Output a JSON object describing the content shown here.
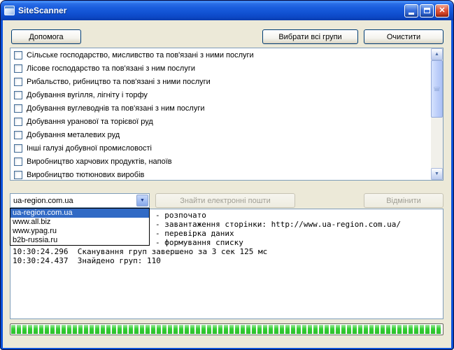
{
  "window": {
    "title": "SiteScanner"
  },
  "toolbar": {
    "help": "Допомога",
    "select_all": "Вибрати всі групи",
    "clear": "Очистити"
  },
  "groups": [
    {
      "label": "Сільське господарство, мисливство та пов'язані з ними послуги",
      "checked": false
    },
    {
      "label": "Лісове господарство та пов'язані з ним послуги",
      "checked": false
    },
    {
      "label": "Рибальство, рибництво та пов'язані з ними послуги",
      "checked": false
    },
    {
      "label": "Добування вугілля, лігніту і торфу",
      "checked": false
    },
    {
      "label": "Добування вуглеводнів та пов'язані з ним послуги",
      "checked": false
    },
    {
      "label": "Добування уранової та торієвої руд",
      "checked": false
    },
    {
      "label": "Добування металевих руд",
      "checked": false
    },
    {
      "label": "Інші галузі добувної промисловості",
      "checked": false
    },
    {
      "label": "Виробництво харчових продуктів, напоїв",
      "checked": false
    },
    {
      "label": "Виробництво тютюнових виробів",
      "checked": false
    }
  ],
  "site_combo": {
    "value": "ua-region.com.ua",
    "options": [
      "ua-region.com.ua",
      "www.all.biz",
      "www.ypag.ru",
      "b2b-russia.ru"
    ]
  },
  "actions": {
    "find_emails": "Знайти електронні пошти",
    "cancel": "Відмінити",
    "find_disabled": true,
    "cancel_disabled": true
  },
  "log_lines": [
    {
      "text": "- розпочато",
      "clipped_left_by_dropdown": true
    },
    {
      "text": "- завантаження сторінки: http://www.ua-region.com.ua/",
      "clipped_left_by_dropdown": true
    },
    {
      "text": "- перевірка даних",
      "clipped_left_by_dropdown": true
    },
    {
      "text": "- формування списку",
      "clipped_left_by_dropdown": true
    },
    {
      "text": "10:30:24.296  Сканування груп завершено за 3 сек 125 мс",
      "clipped_left_by_dropdown": false
    },
    {
      "text": "10:30:24.437  Знайдено груп: 110",
      "clipped_left_by_dropdown": false
    }
  ],
  "progress": {
    "percent": 100
  },
  "icons": {
    "combo_arrow": "▼",
    "scroll_up": "▲",
    "scroll_down": "▼",
    "close": "✕"
  },
  "colors": {
    "titlebar_blue": "#1a5ddd",
    "selection_blue": "#316ac5",
    "progress_green": "#31cf31",
    "close_red": "#e1573b"
  }
}
